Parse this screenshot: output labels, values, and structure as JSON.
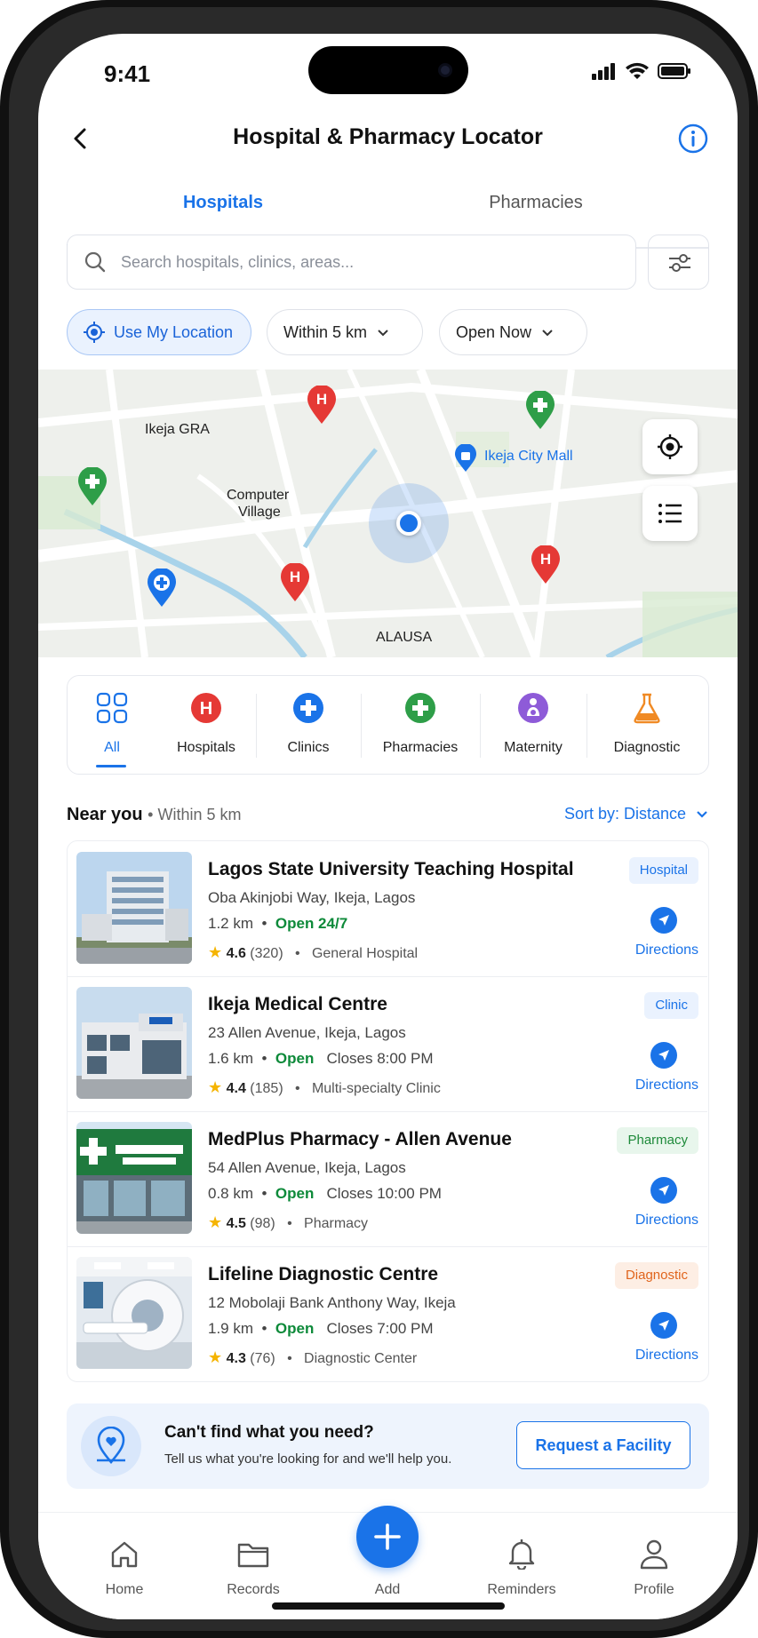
{
  "status": {
    "time": "9:41"
  },
  "header": {
    "title": "Hospital & Pharmacy Locator"
  },
  "tabs": [
    {
      "label": "Hospitals",
      "active": true
    },
    {
      "label": "Pharmacies",
      "active": false
    }
  ],
  "search": {
    "placeholder": "Search hospitals, clinics, areas..."
  },
  "chips": {
    "location": "Use My Location",
    "distance": "Within 5 km",
    "open": "Open Now"
  },
  "map": {
    "labels": {
      "ikeja_gra": "Ikeja GRA",
      "computer_village_1": "Computer",
      "computer_village_2": "Village",
      "mall": "Ikeja City Mall",
      "alausa": "ALAUSA"
    }
  },
  "categories": [
    {
      "label": "All",
      "icon": "grid-icon",
      "active": true
    },
    {
      "label": "Hospitals",
      "icon": "hospital-icon"
    },
    {
      "label": "Clinics",
      "icon": "clinic-icon"
    },
    {
      "label": "Pharmacies",
      "icon": "pharmacy-icon"
    },
    {
      "label": "Maternity",
      "icon": "maternity-icon"
    },
    {
      "label": "Diagnostic",
      "icon": "flask-icon"
    }
  ],
  "near": {
    "title": "Near you",
    "subtitle": "• Within 5 km",
    "sort": "Sort by: Distance"
  },
  "facilities": [
    {
      "name": "Lagos State University Teaching Hospital",
      "address": "Oba Akinjobi Way, Ikeja, Lagos",
      "distance": "1.2 km",
      "status": "Open 24/7",
      "closes": "",
      "rating": "4.6",
      "reviews": "(320)",
      "type": "General Hospital",
      "badge": "Hospital",
      "badge_color": "#1a73e8",
      "badge_bg": "#eaf2fe",
      "directions": "Directions"
    },
    {
      "name": "Ikeja Medical Centre",
      "address": "23 Allen Avenue, Ikeja, Lagos",
      "distance": "1.6 km",
      "status": "Open",
      "closes": "Closes 8:00 PM",
      "rating": "4.4",
      "reviews": "(185)",
      "type": "Multi-specialty Clinic",
      "badge": "Clinic",
      "badge_color": "#1a73e8",
      "badge_bg": "#eaf2fe",
      "directions": "Directions"
    },
    {
      "name": "MedPlus Pharmacy - Allen Avenue",
      "address": "54 Allen Avenue, Ikeja, Lagos",
      "distance": "0.8 km",
      "status": "Open",
      "closes": "Closes 10:00 PM",
      "rating": "4.5",
      "reviews": "(98)",
      "type": "Pharmacy",
      "badge": "Pharmacy",
      "badge_color": "#1e8a3a",
      "badge_bg": "#e8f6ec",
      "directions": "Directions"
    },
    {
      "name": "Lifeline Diagnostic Centre",
      "address": "12 Mobolaji Bank Anthony Way, Ikeja",
      "distance": "1.9 km",
      "status": "Open",
      "closes": "Closes 7:00 PM",
      "rating": "4.3",
      "reviews": "(76)",
      "type": "Diagnostic Center",
      "badge": "Diagnostic",
      "badge_color": "#e0641c",
      "badge_bg": "#fdeee4",
      "directions": "Directions"
    }
  ],
  "banner": {
    "title": "Can't find what you need?",
    "subtitle": "Tell us what you're looking for and we'll help you.",
    "button": "Request a Facility"
  },
  "nav": [
    {
      "label": "Home",
      "icon": "home-icon"
    },
    {
      "label": "Records",
      "icon": "folder-icon"
    },
    {
      "label": "Add",
      "icon": "plus-icon"
    },
    {
      "label": "Reminders",
      "icon": "bell-icon"
    },
    {
      "label": "Profile",
      "icon": "user-icon"
    }
  ],
  "colors": {
    "accent": "#1a73e8",
    "hospital": "#e53935",
    "pharmacy": "#2e9e48",
    "maternity": "#8e5bd8",
    "diagnostic": "#f08a24"
  }
}
